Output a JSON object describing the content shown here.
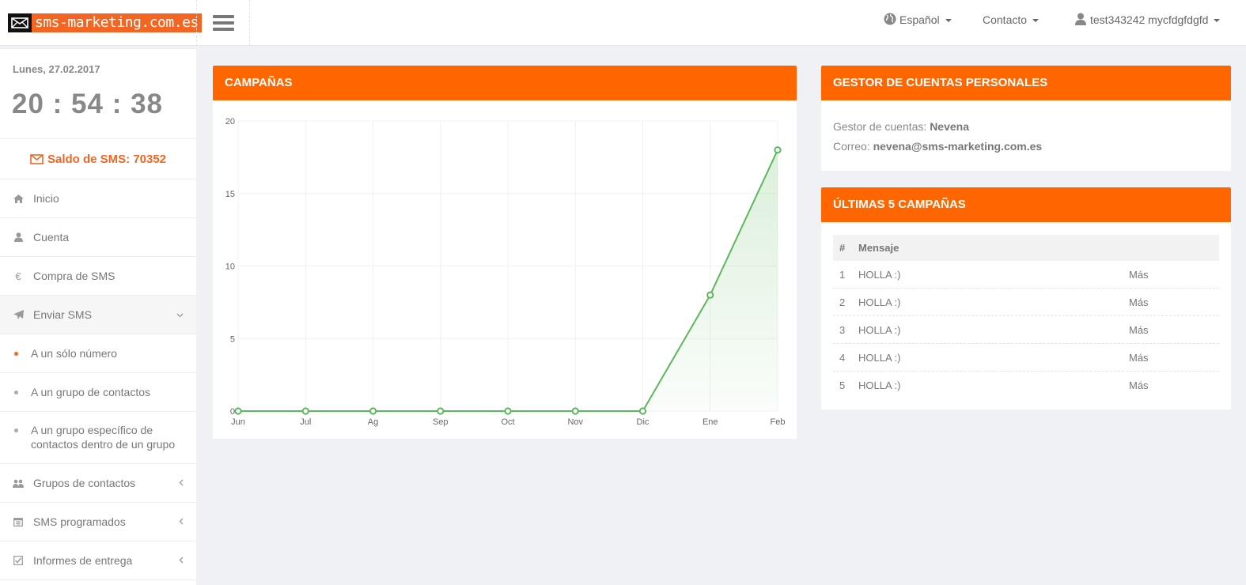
{
  "header": {
    "logo_text": "sms-marketing.com.es",
    "language": "Español",
    "contact": "Contacto",
    "user": "test343242 mycfdgfdgfd"
  },
  "sidebar": {
    "date": "Lunes, 27.02.2017",
    "clock": "20 : 54 : 38",
    "balance": "Saldo de SMS: 70352",
    "items": [
      {
        "label": "Inicio",
        "icon": "home-icon"
      },
      {
        "label": "Cuenta",
        "icon": "user-icon"
      },
      {
        "label": "Compra de SMS",
        "icon": "euro-icon"
      },
      {
        "label": "Enviar SMS",
        "icon": "paper-plane-icon"
      }
    ],
    "sub_items": [
      {
        "label": "A un sólo número"
      },
      {
        "label": "A un grupo de contactos"
      },
      {
        "label": "A un grupo específico de contactos dentro de un grupo"
      }
    ],
    "items_after": [
      {
        "label": "Grupos de contactos",
        "icon": "users-icon"
      },
      {
        "label": "SMS programados",
        "icon": "calendar-icon"
      },
      {
        "label": "Informes de entrega",
        "icon": "check-square-icon"
      }
    ]
  },
  "campaigns_panel": {
    "title": "CAMPAÑAS"
  },
  "chart_data": {
    "type": "area",
    "categories": [
      "Jun",
      "Jul",
      "Ag",
      "Sep",
      "Oct",
      "Nov",
      "Dic",
      "Ene",
      "Feb"
    ],
    "values": [
      0,
      0,
      0,
      0,
      0,
      0,
      0,
      8,
      18
    ],
    "ylim": [
      0,
      20
    ],
    "yticks": [
      0,
      5,
      10,
      15,
      20
    ],
    "grid": true,
    "color": "#5cb85c"
  },
  "account_panel": {
    "title": "GESTOR DE CUENTAS PERSONALES",
    "manager_label": "Gestor de cuentas:",
    "manager_name": "Nevena",
    "email_label": "Correo:",
    "email": "nevena@sms-marketing.com.es"
  },
  "last_campaigns": {
    "title": "ÚLTIMAS 5 CAMPAÑAS",
    "columns": [
      "#",
      "Mensaje"
    ],
    "rows": [
      {
        "num": "1",
        "message": "HOLLA :)",
        "action": "Más"
      },
      {
        "num": "2",
        "message": "HOLLA :)",
        "action": "Más"
      },
      {
        "num": "3",
        "message": "HOLLA :)",
        "action": "Más"
      },
      {
        "num": "4",
        "message": "HOLLA :)",
        "action": "Más"
      },
      {
        "num": "5",
        "message": "HOLLA :)",
        "action": "Más"
      }
    ]
  },
  "colors": {
    "accent": "#ff6600",
    "balance": "#f26522",
    "line": "#5cb85c"
  }
}
